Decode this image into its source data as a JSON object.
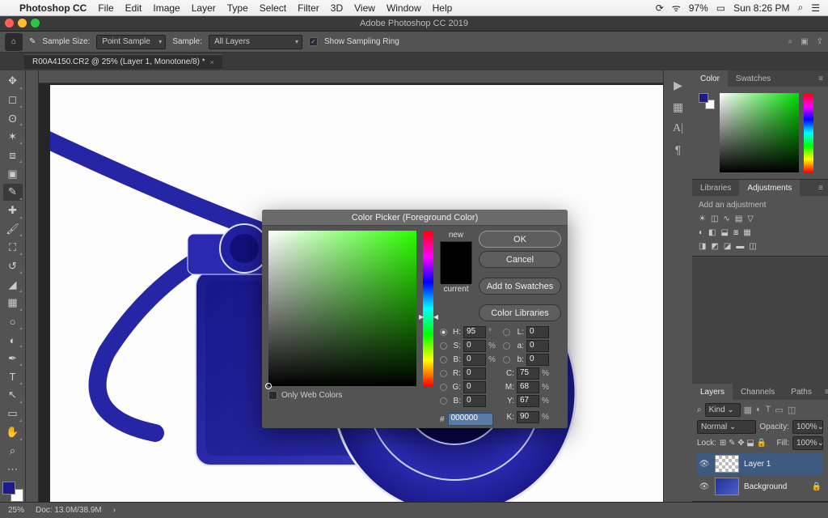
{
  "mac": {
    "app": "Photoshop CC",
    "menus": [
      "File",
      "Edit",
      "Image",
      "Layer",
      "Type",
      "Select",
      "Filter",
      "3D",
      "View",
      "Window",
      "Help"
    ],
    "battery": "97%",
    "clock": "Sun 8:26 PM"
  },
  "window_title": "Adobe Photoshop CC 2019",
  "options": {
    "sample_size_label": "Sample Size:",
    "sample_size_value": "Point Sample",
    "sample_label": "Sample:",
    "sample_value": "All Layers",
    "show_sampling": "Show Sampling Ring"
  },
  "doc_tab": "R00A4150.CR2 @ 25% (Layer 1, Monotone/8) *",
  "footer": {
    "zoom": "25%",
    "info": "Doc: 13.0M/38.9M"
  },
  "panels": {
    "color": "Color",
    "swatches": "Swatches",
    "libraries": "Libraries",
    "adjustments": "Adjustments",
    "add_adj": "Add an adjustment",
    "layers": "Layers",
    "channels": "Channels",
    "paths": "Paths",
    "kind": "Kind",
    "blend": "Normal",
    "opacity_label": "Opacity:",
    "opacity": "100%",
    "lock_label": "Lock:",
    "fill_label": "Fill:",
    "fill": "100%",
    "layer1": "Layer 1",
    "background": "Background"
  },
  "picker": {
    "title": "Color Picker (Foreground Color)",
    "new": "new",
    "current": "current",
    "ok": "OK",
    "cancel": "Cancel",
    "add": "Add to Swatches",
    "lib": "Color Libraries",
    "only_web": "Only Web Colors",
    "H": "95",
    "S": "0",
    "Bv": "0",
    "R": "0",
    "G": "0",
    "Bb": "0",
    "L": "0",
    "a": "0",
    "b": "0",
    "C": "75",
    "M": "68",
    "Y": "67",
    "K": "90",
    "hex": "000000"
  }
}
